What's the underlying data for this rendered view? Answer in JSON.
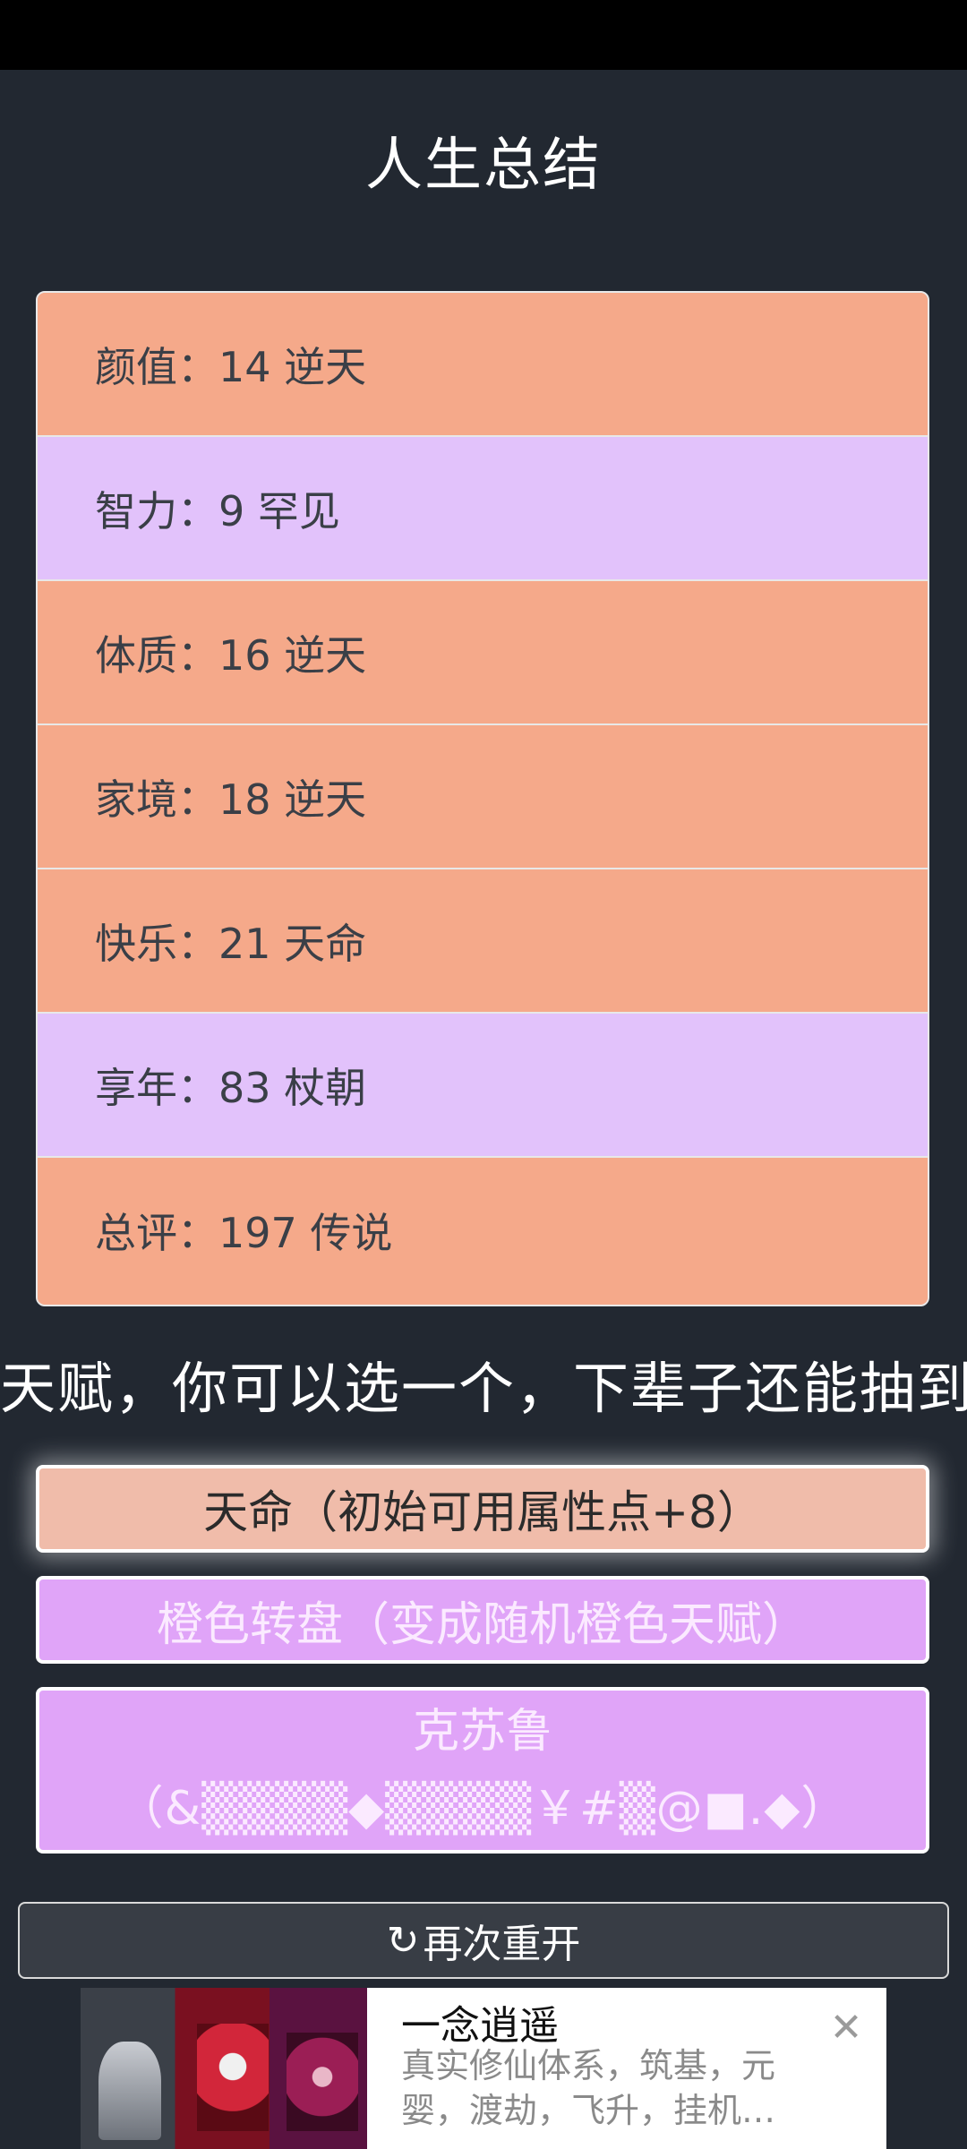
{
  "page": {
    "title": "人生总结"
  },
  "summary": {
    "rows": [
      {
        "text": "颜值：14 逆天",
        "tone": "orange"
      },
      {
        "text": "智力：9 罕见",
        "tone": "purple"
      },
      {
        "text": "体质：16 逆天",
        "tone": "orange"
      },
      {
        "text": "家境：18 逆天",
        "tone": "orange"
      },
      {
        "text": "快乐：21 天命",
        "tone": "orange"
      },
      {
        "text": "享年：83 杖朝",
        "tone": "purple"
      },
      {
        "text": "总评：197 传说",
        "tone": "orange"
      }
    ]
  },
  "prompt": "天赋，你可以选一个，下辈子还能抽到",
  "talents": [
    {
      "label": "天命（初始可用属性点+8）"
    },
    {
      "label": "橙色转盘（变成随机橙色天赋）"
    },
    {
      "label_line1": "克苏鲁",
      "label_line2": "（&▒▒▒▒◆▒▒▒▒￥#▒@■.◆）"
    }
  ],
  "restart": {
    "icon": "refresh-icon",
    "label": "再次重开"
  },
  "ad": {
    "title": "一念逍遥",
    "description": "真实修仙体系，筑基，元婴，渡劫，飞升，挂机…",
    "close_icon": "close-icon"
  },
  "colors": {
    "background": "#222831",
    "orange": "#f5a98a",
    "purple": "#e2c2fb",
    "selected_talent": "#f0bcaa",
    "talent_purple": "#e0a4f8"
  }
}
